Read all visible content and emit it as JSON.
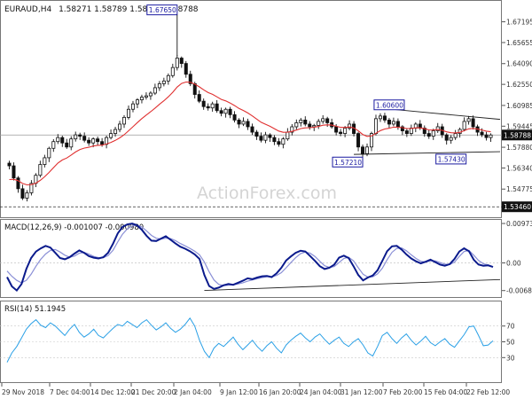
{
  "header": {
    "symbol": "EURAUD,H4",
    "ohlc": "1.58271 1.58789 1.58249 1.58788"
  },
  "watermark": "ActionForex.com",
  "colors": {
    "candle": "#111111",
    "ema": "#e03030",
    "macd_main": "#0a1a8c",
    "macd_signal": "#8a8fd6",
    "rsi": "#2aa0e6",
    "axis": "#555555",
    "line_annot": "#222222",
    "label_border": "#1a1aa0",
    "label_bg": "#ffffff",
    "price_label_bg": "#111111",
    "price_label_text": "#ffffff"
  },
  "chart_data": [
    {
      "type": "candlestick",
      "title": "EURAUD,H4",
      "ylim": [
        1.5275,
        1.6855
      ],
      "price_ticks": [
        "1.67195",
        "1.65655",
        "1.64090",
        "1.62550",
        "1.60985",
        "1.59445",
        "1.57880",
        "1.56340",
        "1.54775"
      ],
      "last_price": "1.58788",
      "price_level_tags": [
        "1.53460"
      ],
      "annotations": [
        {
          "label": "1.67650",
          "at": "2 Jan high",
          "value": 1.6765
        },
        {
          "label": "1.57210",
          "at": "28 Jan low",
          "value": 1.5721
        },
        {
          "label": "1.60600",
          "at": "7 Feb high",
          "value": 1.606
        },
        {
          "label": "1.57430",
          "at": "18 Feb low",
          "value": 1.5743
        }
      ],
      "overlays": [
        "moving average (red)",
        "triangle trendlines",
        "support level 1.53460"
      ],
      "series": [
        {
          "name": "close",
          "values": [
            1.565,
            1.556,
            1.548,
            1.541,
            1.545,
            1.552,
            1.558,
            1.566,
            1.571,
            1.578,
            1.583,
            1.586,
            1.582,
            1.579,
            1.585,
            1.588,
            1.587,
            1.584,
            1.582,
            1.585,
            1.583,
            1.581,
            1.586,
            1.589,
            1.592,
            1.596,
            1.601,
            1.607,
            1.611,
            1.614,
            1.616,
            1.617,
            1.619,
            1.623,
            1.626,
            1.628,
            1.632,
            1.638,
            1.645,
            1.641,
            1.633,
            1.626,
            1.618,
            1.613,
            1.609,
            1.608,
            1.611,
            1.606,
            1.604,
            1.607,
            1.603,
            1.599,
            1.596,
            1.598,
            1.594,
            1.59,
            1.587,
            1.584,
            1.588,
            1.586,
            1.583,
            1.581,
            1.585,
            1.59,
            1.594,
            1.597,
            1.599,
            1.596,
            1.594,
            1.595,
            1.598,
            1.6,
            1.597,
            1.594,
            1.59,
            1.589,
            1.593,
            1.596,
            1.589,
            1.579,
            1.574,
            1.579,
            1.589,
            1.6,
            1.602,
            1.599,
            1.596,
            1.598,
            1.594,
            1.591,
            1.589,
            1.593,
            1.596,
            1.593,
            1.589,
            1.587,
            1.591,
            1.594,
            1.588,
            1.584,
            1.586,
            1.589,
            1.592,
            1.598,
            1.6,
            1.594,
            1.59,
            1.588,
            1.586,
            1.5879
          ]
        }
      ],
      "x_ticks": [
        "29 Nov 2018",
        "7 Dec 04:00",
        "14 Dec 12:00",
        "21 Dec 20:00",
        "2 Jan 04:00",
        "9 Jan 12:00",
        "16 Jan 20:00",
        "24 Jan 04:00",
        "31 Jan 12:00",
        "7 Feb 20:00",
        "15 Feb 04:00",
        "22 Feb 12:00"
      ]
    },
    {
      "type": "line",
      "title": "MACD(12,26,9) -0.001007 -0.000980",
      "ylim": [
        -0.0082,
        0.0104
      ],
      "y_ticks": [
        "0.009734",
        "0.00",
        "-0.006826"
      ],
      "series": [
        {
          "name": "main",
          "values": [
            -0.0035,
            -0.0058,
            -0.0068,
            -0.0052,
            -0.0015,
            0.0012,
            0.0028,
            0.0036,
            0.0042,
            0.0038,
            0.0025,
            0.0012,
            0.0009,
            0.0014,
            0.0023,
            0.0031,
            0.0025,
            0.0017,
            0.0013,
            0.0011,
            0.0014,
            0.0025,
            0.0047,
            0.0073,
            0.0089,
            0.0095,
            0.0097,
            0.0093,
            0.0082,
            0.0067,
            0.0055,
            0.0054,
            0.006,
            0.0066,
            0.0057,
            0.0048,
            0.004,
            0.0035,
            0.0029,
            0.0021,
            0.001,
            -0.003,
            -0.0057,
            -0.0064,
            -0.0061,
            -0.0055,
            -0.0052,
            -0.0054,
            -0.0049,
            -0.0044,
            -0.0038,
            -0.004,
            -0.0036,
            -0.0033,
            -0.0032,
            -0.0035,
            -0.0026,
            -0.0012,
            0.0006,
            0.0016,
            0.0025,
            0.003,
            0.0028,
            0.0017,
            0.0005,
            -0.0008,
            -0.0015,
            -0.0012,
            -0.0004,
            0.0013,
            0.0018,
            0.0012,
            -0.0008,
            -0.003,
            -0.0043,
            -0.0036,
            -0.0031,
            -0.0018,
            0.0005,
            0.0029,
            0.0041,
            0.0042,
            0.0033,
            0.0021,
            0.0011,
            0.0004,
            -0.0001,
            0.0003,
            0.0008,
            0.0002,
            -0.0004,
            -0.0007,
            -0.0003,
            0.001,
            0.0028,
            0.0036,
            0.0029,
            0.0008,
            -0.0004,
            -0.0007,
            -0.0006,
            -0.001
          ]
        },
        {
          "name": "signal",
          "values": [
            -0.002,
            -0.0033,
            -0.0043,
            -0.0049,
            -0.0043,
            -0.0028,
            -0.0008,
            0.0009,
            0.0022,
            0.0031,
            0.0033,
            0.0027,
            0.0019,
            0.0014,
            0.0017,
            0.0024,
            0.0026,
            0.0022,
            0.0016,
            0.0013,
            0.0013,
            0.0018,
            0.0031,
            0.0052,
            0.0071,
            0.0084,
            0.0091,
            0.0093,
            0.0089,
            0.0079,
            0.0068,
            0.0061,
            0.0059,
            0.0061,
            0.006,
            0.0055,
            0.0048,
            0.0042,
            0.0036,
            0.0029,
            0.002,
            0.0002,
            -0.0022,
            -0.0042,
            -0.0053,
            -0.0056,
            -0.0055,
            -0.0054,
            -0.0052,
            -0.0049,
            -0.0045,
            -0.0042,
            -0.0039,
            -0.0036,
            -0.0034,
            -0.0034,
            -0.0031,
            -0.0024,
            -0.0012,
            0.0001,
            0.0013,
            0.0023,
            0.0027,
            0.0024,
            0.0016,
            0.0004,
            -0.0007,
            -0.0011,
            -0.0009,
            0.0001,
            0.0011,
            0.0014,
            0.0005,
            -0.0012,
            -0.0028,
            -0.0035,
            -0.0034,
            -0.0027,
            -0.0013,
            0.0008,
            0.0026,
            0.0036,
            0.0037,
            0.003,
            0.002,
            0.0011,
            0.0004,
            0.0002,
            0.0005,
            0.0005,
            0.0001,
            -0.0003,
            -0.0004,
            0.0002,
            0.0016,
            0.0028,
            0.0031,
            0.0019,
            0.0006,
            -0.0002,
            -0.0005,
            -0.00098
          ]
        }
      ]
    },
    {
      "type": "line",
      "title": "RSI(14) 51.1945",
      "ylim": [
        0,
        100
      ],
      "y_ticks": [
        70,
        50,
        30
      ],
      "series": [
        {
          "name": "rsi",
          "values": [
            24,
            36,
            44,
            55,
            66,
            73,
            78,
            71,
            68,
            74,
            70,
            64,
            58,
            66,
            72,
            62,
            56,
            60,
            66,
            58,
            55,
            61,
            67,
            72,
            70,
            76,
            72,
            68,
            74,
            78,
            71,
            65,
            69,
            74,
            67,
            62,
            66,
            72,
            80,
            70,
            52,
            38,
            30,
            42,
            48,
            44,
            50,
            56,
            47,
            40,
            46,
            52,
            44,
            38,
            45,
            50,
            42,
            36,
            46,
            52,
            57,
            61,
            55,
            50,
            56,
            60,
            53,
            47,
            52,
            56,
            48,
            44,
            50,
            54,
            46,
            36,
            32,
            44,
            58,
            62,
            54,
            48,
            55,
            60,
            52,
            46,
            51,
            57,
            49,
            45,
            50,
            54,
            47,
            43,
            51,
            59,
            69,
            70,
            58,
            45,
            46,
            51.1945
          ]
        }
      ]
    }
  ]
}
